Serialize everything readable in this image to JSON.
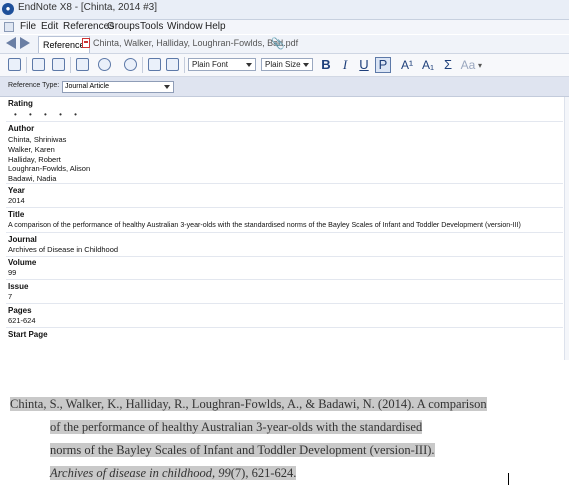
{
  "window": {
    "title": "EndNote X8 - [Chinta, 2014 #3]",
    "app_icon": "endnote-icon"
  },
  "menu": [
    "File",
    "Edit",
    "References",
    "Groups",
    "Tools",
    "Window",
    "Help"
  ],
  "tabs": {
    "reference_label": "Reference",
    "pdf_label": "Chinta, Walker, Halliday, Loughran-Fowlds, Bad.pdf"
  },
  "toolbar": {
    "font_select": "Plain Font",
    "size_select": "Plain Size",
    "bold": "B",
    "italic": "I",
    "underline": "U",
    "plain": "P",
    "superscript": "A¹",
    "subscript": "A₁",
    "symbol": "Σ",
    "case": "Aa"
  },
  "reference_type": {
    "label": "Reference Type:",
    "value": "Journal Article"
  },
  "fields": {
    "rating_label": "Rating",
    "rating_dots": "• • • • •",
    "author_label": "Author",
    "authors": [
      "Chinta, Shriniwas",
      "Walker, Karen",
      "Halliday, Robert",
      "Loughran-Fowlds, Alison",
      "Badawi, Nadia"
    ],
    "year_label": "Year",
    "year": "2014",
    "title_label": "Title",
    "title": "A comparison of the performance of healthy Australian 3-year-olds with the standardised norms of the Bayley Scales of Infant and Toddler Development (version-III)",
    "journal_label": "Journal",
    "journal": "Archives of Disease in Childhood",
    "volume_label": "Volume",
    "volume": "99",
    "issue_label": "Issue",
    "issue": "7",
    "pages_label": "Pages",
    "pages": "621-624",
    "start_page_label": "Start Page"
  },
  "citation": {
    "line1": "Chinta, S., Walker, K., Halliday, R., Loughran-Fowlds, A., & Badawi, N. (2014). A comparison",
    "line2": "of the performance of healthy Australian 3-year-olds with the standardised",
    "line3": "norms of the Bayley Scales of Infant and Toddler Development (version-III).",
    "line4_italic": "Archives of disease in childhood, 99",
    "line4_rest": "(7), 621-624."
  },
  "colors": {
    "highlight": "#c9c9c9",
    "toolbar_icon": "#5d79a8",
    "ref_row": "#dfe4f0"
  }
}
